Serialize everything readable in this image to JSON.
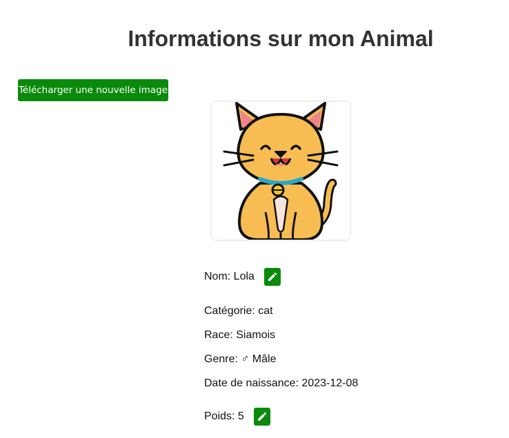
{
  "page": {
    "title": "Informations sur mon Animal"
  },
  "actions": {
    "upload_label": "Télécharger une nouvelle image"
  },
  "pet": {
    "name_label": "Nom: Lola",
    "category_label": "Catégorie: cat",
    "breed_label": "Race: Siamois",
    "gender_label": "Genre: ♂ Mâle",
    "birthdate_label": "Date de naissance: 2023-12-08",
    "weight_label": "Poids: 5"
  },
  "icons": {
    "edit": "pencil-icon"
  },
  "colors": {
    "accent_green": "#0a8a0a",
    "title_text": "#333333"
  }
}
